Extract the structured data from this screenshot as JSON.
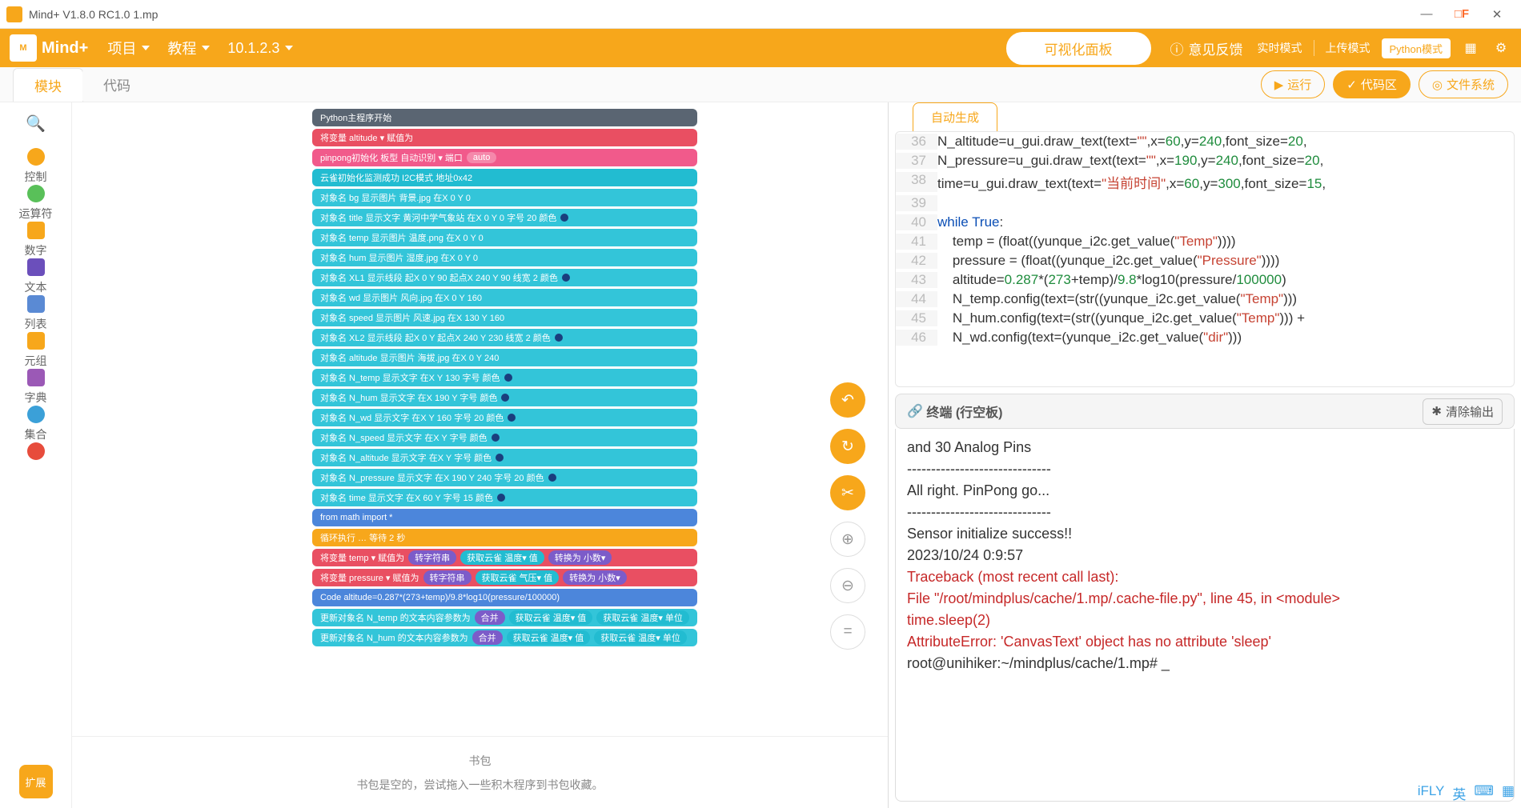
{
  "window": {
    "title": "Mind+ V1.8.0 RC1.0   1.mp"
  },
  "topbar": {
    "brand": "Mind+",
    "menus": [
      "项目",
      "教程",
      "10.1.2.3"
    ],
    "visual_panel": "可视化面板",
    "feedback": "意见反馈",
    "modes": [
      "实时模式",
      "上传模式"
    ],
    "python_mode": "Python模式"
  },
  "tabs": {
    "blocks": "模块",
    "code": "代码"
  },
  "rightbtns": {
    "run": "运行",
    "codezone": "代码区",
    "filesystem": "文件系统"
  },
  "cats": [
    {
      "label": "控制",
      "color": "#f7a71b"
    },
    {
      "label": "运算符",
      "color": "#59c059"
    },
    {
      "label": "数字",
      "color": "#f7a71b",
      "sq": true
    },
    {
      "label": "文本",
      "color": "#6b4fbb",
      "sq": true
    },
    {
      "label": "列表",
      "color": "#5a8ad4",
      "sq": true
    },
    {
      "label": "元组",
      "color": "#f7a71b",
      "sq": true
    },
    {
      "label": "字典",
      "color": "#9b59b6",
      "sq": true
    },
    {
      "label": "集合",
      "color": "#3ba0d8"
    },
    {
      "label": "",
      "color": "#e74c3c"
    }
  ],
  "ext": "扩展",
  "blocks": [
    {
      "c": "gray",
      "t": "Python主程序开始"
    },
    {
      "c": "red",
      "t": "将变量 altitude ▾ 赋值为"
    },
    {
      "c": "pink",
      "t": "pinpong初始化 板型 自动识别 ▾ 端口",
      "p": "auto"
    },
    {
      "c": "teal",
      "t": "云雀初始化监测成功 I2C模式 地址0x42"
    },
    {
      "c": "tealL",
      "t": "对象名 bg 显示图片 背景.jpg 在X 0 Y 0"
    },
    {
      "c": "tealL",
      "t": "对象名 title 显示文字 黄河中学气象站 在X 0 Y 0 字号 20 颜色",
      "d": true
    },
    {
      "c": "tealL",
      "t": "对象名 temp 显示图片 温度.png 在X 0 Y 0"
    },
    {
      "c": "tealL",
      "t": "对象名 hum 显示图片 湿度.jpg 在X 0 Y 0"
    },
    {
      "c": "tealL",
      "t": "对象名 XL1 显示线段 起X 0 Y 90 起点X 240 Y 90 线宽 2 颜色",
      "d": true
    },
    {
      "c": "tealL",
      "t": "对象名 wd 显示图片 风向.jpg 在X 0 Y 160"
    },
    {
      "c": "tealL",
      "t": "对象名 speed 显示图片 风速.jpg 在X 130 Y 160"
    },
    {
      "c": "tealL",
      "t": "对象名 XL2 显示线段 起X 0 Y 起点X 240 Y 230 线宽 2 颜色",
      "d": true
    },
    {
      "c": "tealL",
      "t": "对象名 altitude 显示图片 海拔.jpg 在X 0 Y 240"
    },
    {
      "c": "tealL",
      "t": "对象名 N_temp 显示文字 在X Y 130 字号 颜色",
      "d": true
    },
    {
      "c": "tealL",
      "t": "对象名 N_hum 显示文字 在X 190 Y  字号 颜色",
      "d": true
    },
    {
      "c": "tealL",
      "t": "对象名 N_wd 显示文字 在X Y 160 字号 20 颜色",
      "d": true
    },
    {
      "c": "tealL",
      "t": "对象名 N_speed 显示文字 在X Y 字号 颜色",
      "d": true
    },
    {
      "c": "tealL",
      "t": "对象名 N_altitude 显示文字 在X Y 字号 颜色",
      "d": true
    },
    {
      "c": "tealL",
      "t": "对象名 N_pressure 显示文字 在X 190 Y 240 字号 20 颜色",
      "d": true
    },
    {
      "c": "tealL",
      "t": "对象名 time 显示文字 在X 60 Y 字号 15 颜色",
      "d": true
    },
    {
      "c": "blue",
      "t": "from math import *"
    },
    {
      "c": "orange",
      "t": "循环执行 … 等待 2 秒"
    },
    {
      "c": "red",
      "t": "将变量 temp ▾ 赋值为",
      "e": [
        "purple:转字符串",
        "teal:获取云雀 温度▾ 值",
        "purple:转换为 小数▾"
      ]
    },
    {
      "c": "red",
      "t": "将变量 pressure ▾ 赋值为",
      "e": [
        "purple:转字符串",
        "teal:获取云雀 气压▾ 值",
        "purple:转换为 小数▾"
      ]
    },
    {
      "c": "blue",
      "t": "Code altitude=0.287*(273+temp)/9.8*log10(pressure/100000)"
    },
    {
      "c": "tealL",
      "t": "更新对象名 N_temp 的文本内容参数为",
      "e": [
        "purple:合并",
        "teal:获取云雀 温度▾ 值",
        "teal:获取云雀 温度▾ 单位"
      ]
    },
    {
      "c": "tealL",
      "t": "更新对象名 N_hum 的文本内容参数为",
      "e": [
        "purple:合并",
        "teal:获取云雀 温度▾ 值",
        "teal:获取云雀 温度▾ 单位"
      ]
    }
  ],
  "footer": {
    "bag": "书包",
    "empty": "书包是空的，尝试拖入一些积木程序到书包收藏。"
  },
  "codetab": "自动生成",
  "codelines": [
    {
      "n": 36,
      "html": "N_altitude=u_gui.draw_text(text=<span class='str'>\"\"</span>,x=<span class='num'>60</span>,y=<span class='num'>240</span>,font_size=<span class='num'>20</span>,"
    },
    {
      "n": 37,
      "html": "N_pressure=u_gui.draw_text(text=<span class='str'>\"\"</span>,x=<span class='num'>190</span>,y=<span class='num'>240</span>,font_size=<span class='num'>20</span>,"
    },
    {
      "n": 38,
      "html": "time=u_gui.draw_text(text=<span class='str'>\"当前时间\"</span>,x=<span class='num'>60</span>,y=<span class='num'>300</span>,font_size=<span class='num'>15</span>,"
    },
    {
      "n": 39,
      "html": ""
    },
    {
      "n": 40,
      "html": "<span class='kw'>while</span> <span class='kw'>True</span>:"
    },
    {
      "n": 41,
      "html": "    temp = (<span class='fn'>float</span>((yunque_i2c.get_value(<span class='str'>\"Temp\"</span>))))"
    },
    {
      "n": 42,
      "html": "    pressure = (<span class='fn'>float</span>((yunque_i2c.get_value(<span class='str'>\"Pressure\"</span>))))"
    },
    {
      "n": 43,
      "html": "    altitude=<span class='num'>0.287</span>*(<span class='num'>273</span>+temp)/<span class='num'>9.8</span>*log10(pressure/<span class='num'>100000</span>)"
    },
    {
      "n": 44,
      "html": "    N_temp.config(text=(<span class='fn'>str</span>((yunque_i2c.get_value(<span class='str'>\"Temp\"</span>)))"
    },
    {
      "n": 45,
      "html": "    N_hum.config(text=(<span class='fn'>str</span>((yunque_i2c.get_value(<span class='str'>\"Temp\"</span>))) +"
    },
    {
      "n": 46,
      "html": "    N_wd.config(text=(yunque_i2c.get_value(<span class='str'>\"dir\"</span>)))"
    }
  ],
  "terminal": {
    "title": "终端 (行空板)",
    "clear": "清除输出",
    "lines": [
      {
        "t": "and 30 Analog Pins"
      },
      {
        "t": "------------------------------"
      },
      {
        "t": "All right. PinPong go..."
      },
      {
        "t": "------------------------------"
      },
      {
        "t": ""
      },
      {
        "t": "Sensor initialize success!!"
      },
      {
        "t": "2023/10/24 0:9:57"
      },
      {
        "t": "Traceback (most recent call last):",
        "err": true
      },
      {
        "t": "  File \"/root/mindplus/cache/1.mp/.cache-file.py\", line 45, in <module>",
        "err": true
      },
      {
        "t": "    time.sleep(2)",
        "err": true
      },
      {
        "t": "AttributeError: 'CanvasText' object has no attribute 'sleep'",
        "err": true
      },
      {
        "t": "root@unihiker:~/mindplus/cache/1.mp# _"
      }
    ]
  }
}
